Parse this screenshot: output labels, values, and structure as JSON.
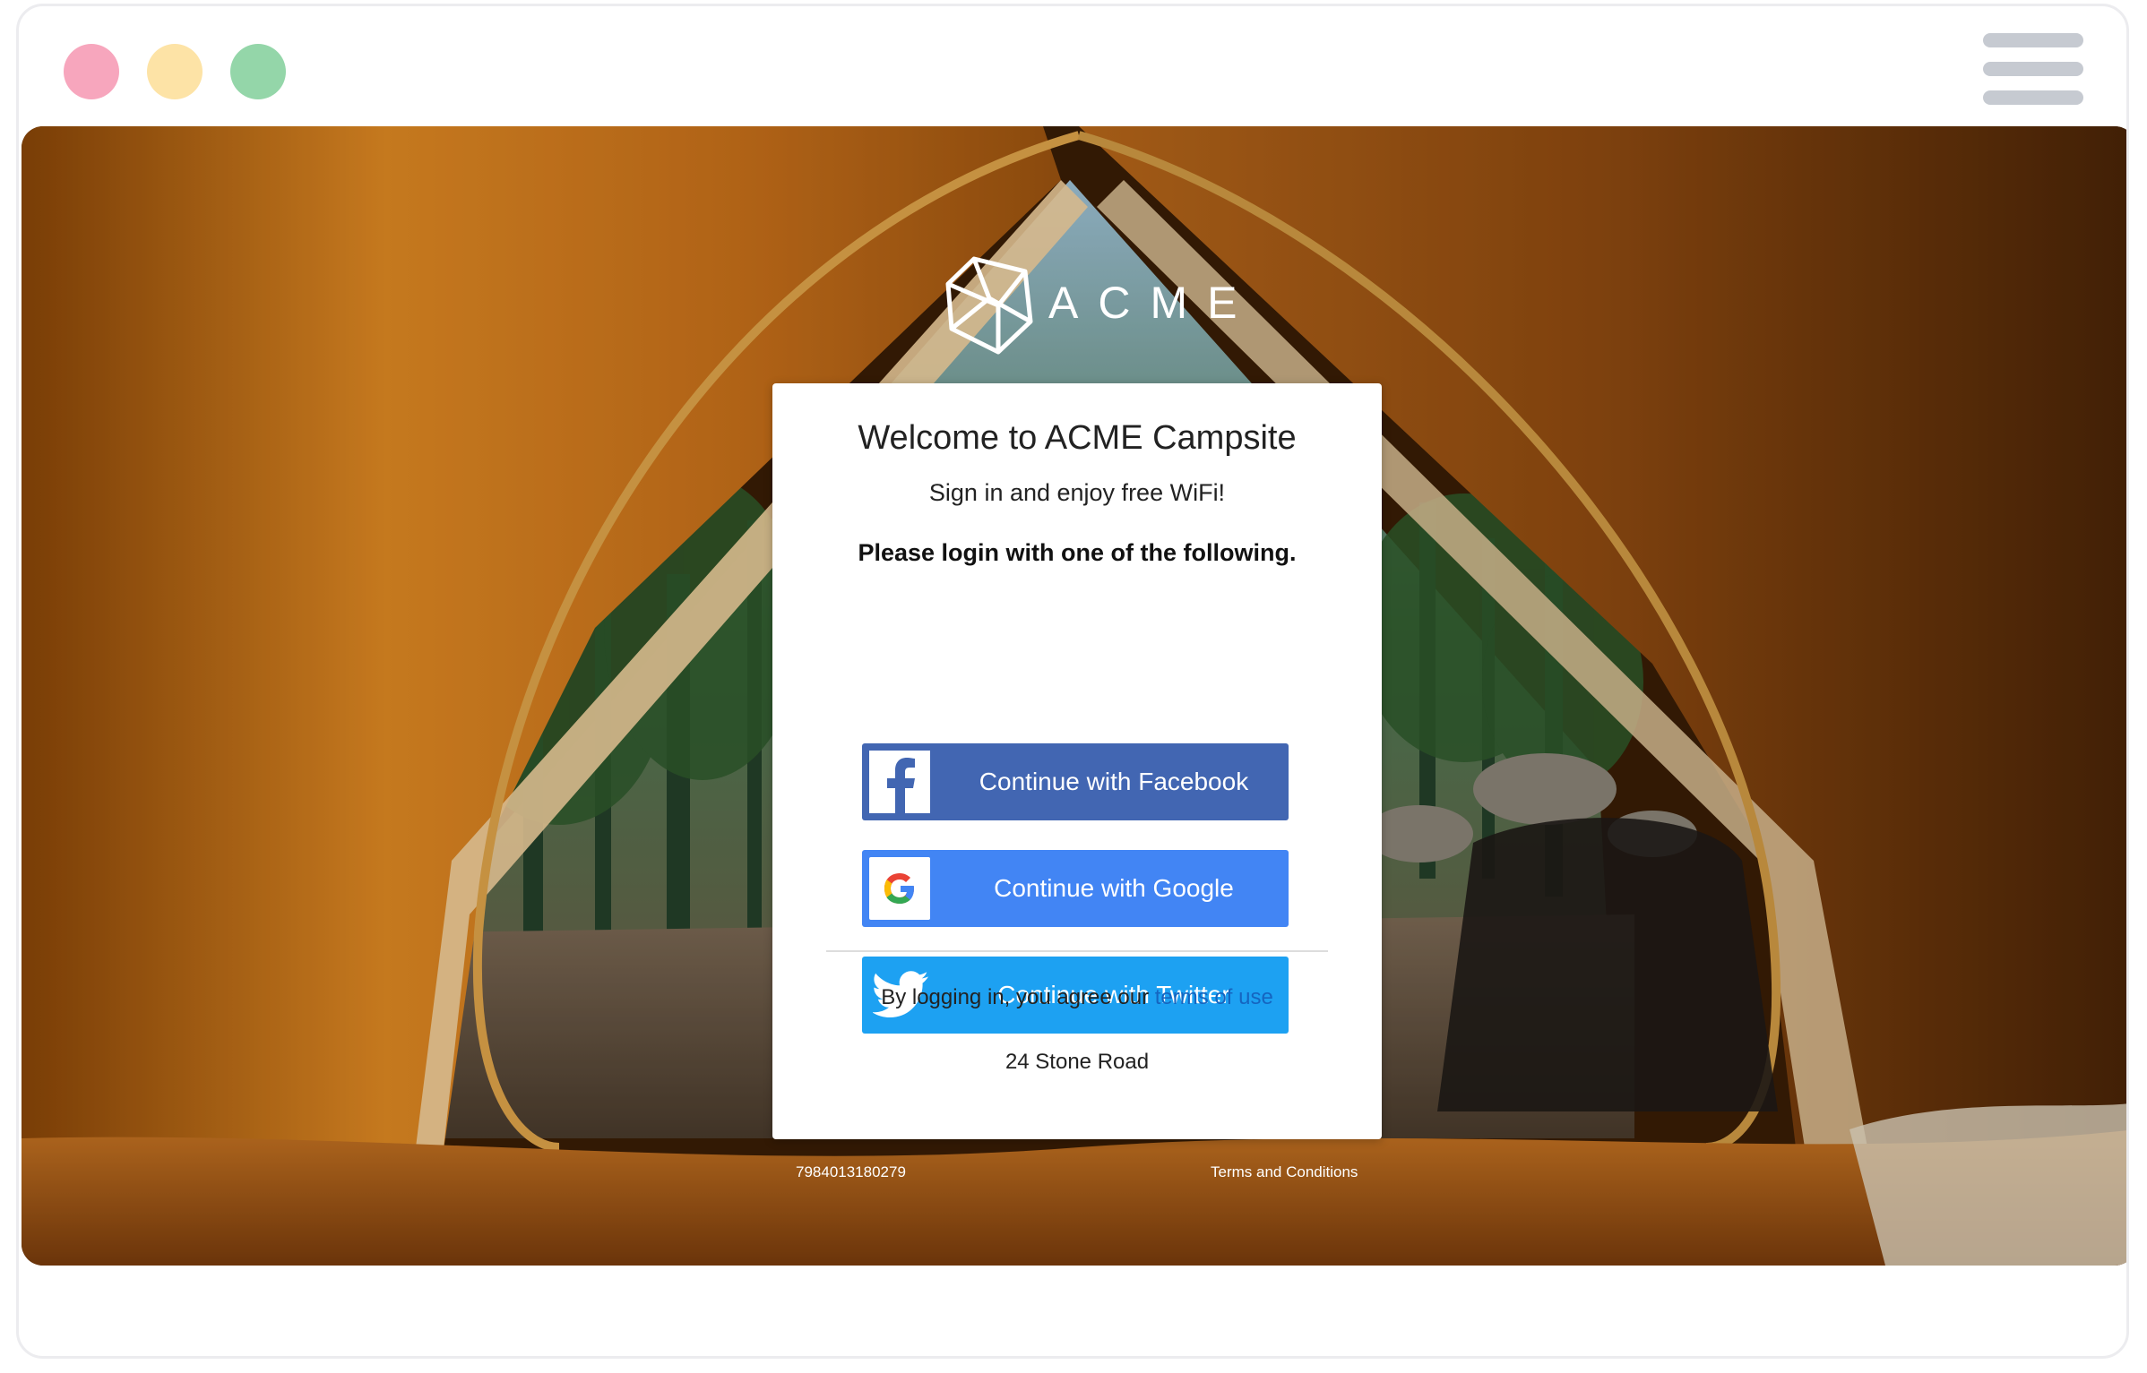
{
  "brand": {
    "logo_text": "ACME"
  },
  "card": {
    "title": "Welcome to ACME Campsite",
    "subtitle": "Sign in and enjoy free WiFi!",
    "instruction": "Please login with one of the following.",
    "buttons": {
      "facebook": "Continue with Facebook",
      "google": "Continue with Google",
      "twitter": "Continue with Twitter"
    },
    "agreement_prefix": "By logging in, you agree our",
    "terms_link": "terms of use",
    "address": "24 Stone Road"
  },
  "footer": {
    "id": "7984013180279",
    "terms": "Terms and Conditions"
  },
  "colors": {
    "facebook": "#4266b2",
    "google": "#4285f4",
    "twitter": "#1da1f2",
    "link": "#1565c0",
    "tent_orange": "#d27a1c"
  },
  "window": {
    "controls": [
      "close-dot",
      "minimize-dot",
      "maximize-dot"
    ],
    "menu_icon": "hamburger-icon"
  }
}
